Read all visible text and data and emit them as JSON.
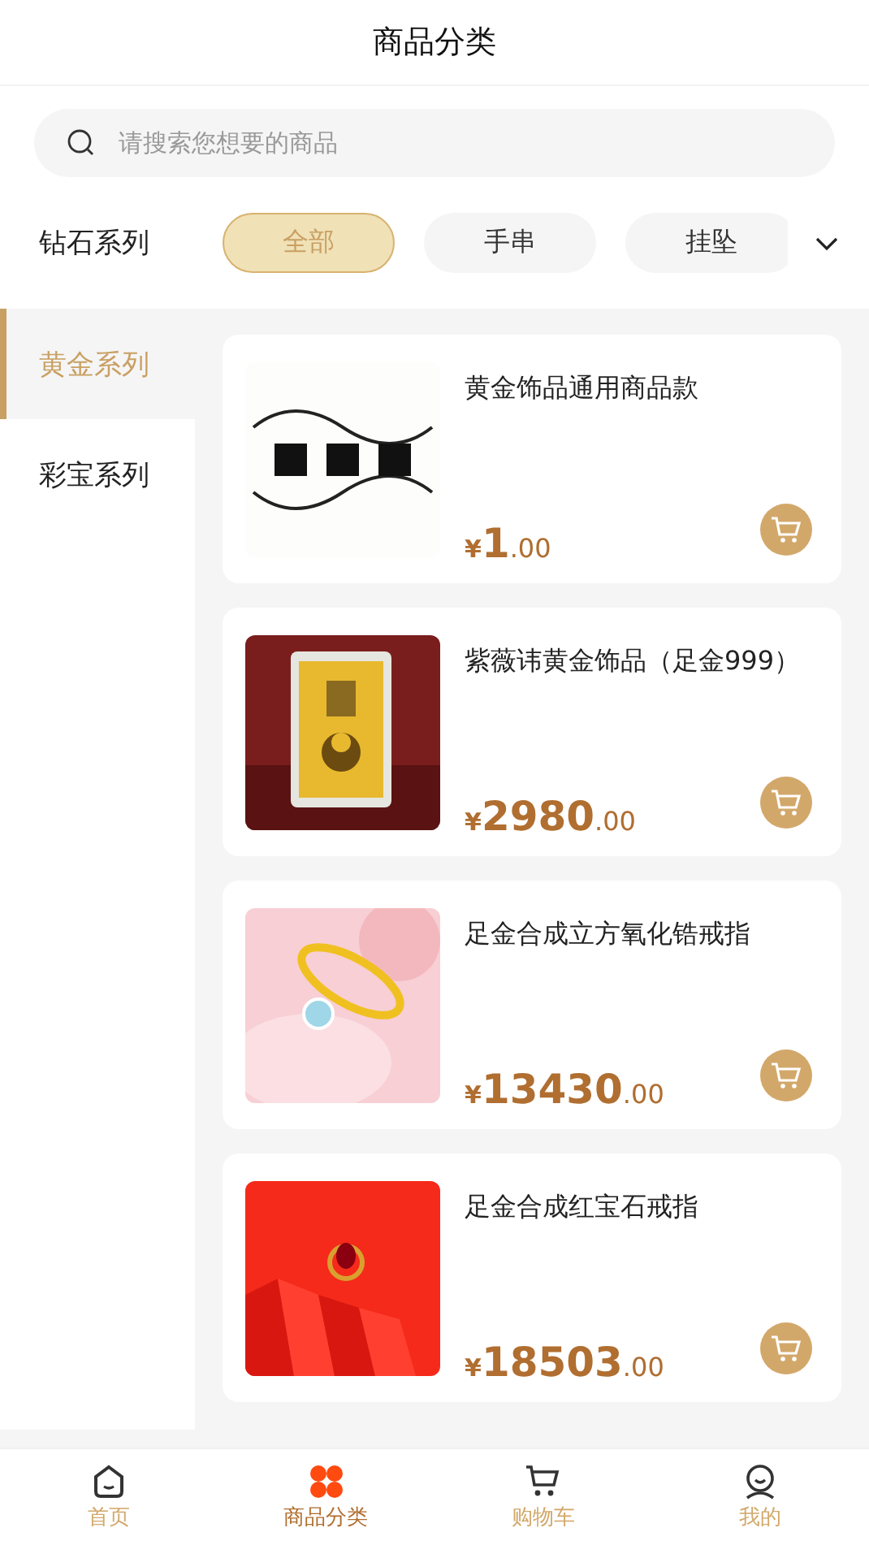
{
  "header": {
    "title": "商品分类"
  },
  "search": {
    "placeholder": "请搜索您想要的商品"
  },
  "filter": {
    "label": "钻石系列",
    "chips": [
      {
        "label": "全部",
        "selected": true
      },
      {
        "label": "手串",
        "selected": false
      },
      {
        "label": "挂坠",
        "selected": false
      }
    ]
  },
  "sidebar": {
    "items": [
      {
        "label": "黄金系列",
        "selected": true
      },
      {
        "label": "彩宝系列",
        "selected": false
      }
    ]
  },
  "products": [
    {
      "name": "黄金饰品通用商品款",
      "currency": "¥",
      "integer": "1",
      "decimal": ".00"
    },
    {
      "name": "紫薇讳黄金饰品（足金999）",
      "currency": "¥",
      "integer": "2980",
      "decimal": ".00"
    },
    {
      "name": "足金合成立方氧化锆戒指",
      "currency": "¥",
      "integer": "13430",
      "decimal": ".00"
    },
    {
      "name": "足金合成红宝石戒指",
      "currency": "¥",
      "integer": "18503",
      "decimal": ".00"
    }
  ],
  "tabbar": [
    {
      "label": "首页",
      "selected": false
    },
    {
      "label": "商品分类",
      "selected": true
    },
    {
      "label": "购物车",
      "selected": false
    },
    {
      "label": "我的",
      "selected": false
    }
  ]
}
